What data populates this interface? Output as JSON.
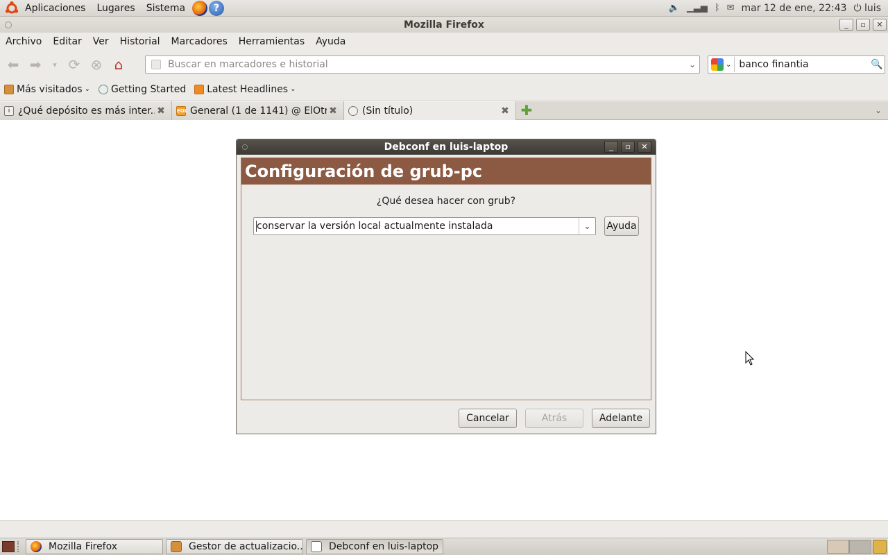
{
  "top_panel": {
    "menus": [
      "Aplicaciones",
      "Lugares",
      "Sistema"
    ],
    "datetime": "mar 12 de ene, 22:43",
    "user": "luis"
  },
  "firefox": {
    "title": "Mozilla Firefox",
    "menubar": [
      "Archivo",
      "Editar",
      "Ver",
      "Historial",
      "Marcadores",
      "Herramientas",
      "Ayuda"
    ],
    "url_placeholder": "Buscar en marcadores e historial",
    "search_value": "banco finantia",
    "bookmarks": [
      "Más visitados",
      "Getting Started",
      "Latest Headlines"
    ],
    "tabs": [
      {
        "label": "¿Qué depósito es más inter...",
        "active": false
      },
      {
        "label": "General (1 de 1141) @ ElOtr...",
        "active": false
      },
      {
        "label": "(Sin título)",
        "active": true
      }
    ]
  },
  "dialog": {
    "title": "Debconf en luis-laptop",
    "header": "Configuración de grub-pc",
    "question": "¿Qué desea hacer con grub?",
    "selected_option": "conservar la versión local actualmente instalada",
    "help_label": "Ayuda",
    "cancel_label": "Cancelar",
    "back_label": "Atrás",
    "forward_label": "Adelante"
  },
  "taskbar": {
    "tasks": [
      {
        "label": "Mozilla Firefox",
        "icon": "firefox-icon"
      },
      {
        "label": "Gestor de actualizacio...",
        "icon": "update-manager-icon"
      },
      {
        "label": "Debconf en luis-laptop",
        "icon": "debconf-icon"
      }
    ]
  }
}
